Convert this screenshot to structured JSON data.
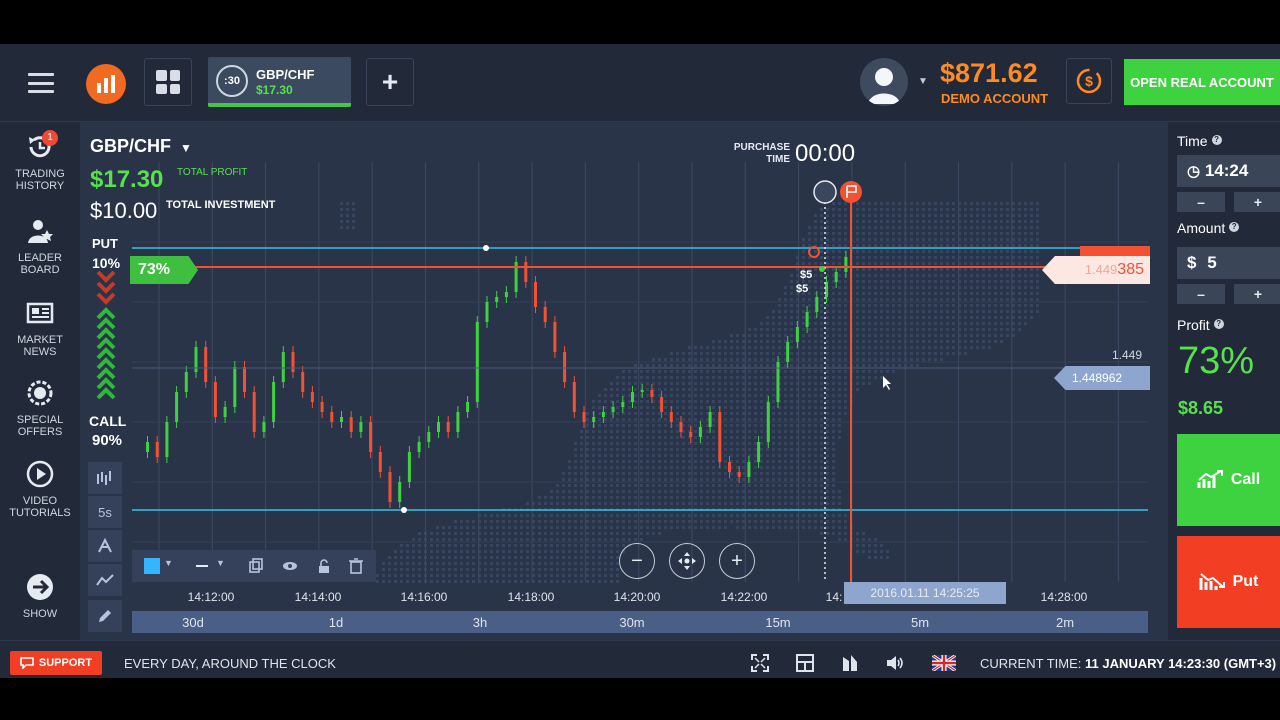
{
  "topbar": {
    "asset_tab": {
      "timer": ":30",
      "name": "GBP/CHF",
      "value": "$17.30"
    },
    "add_tab": "+",
    "balance": "$871.62",
    "account_type": "DEMO ACCOUNT",
    "open_real_label": "OPEN REAL ACCOUNT"
  },
  "sidebar": {
    "items": [
      {
        "label": "TRADING HISTORY",
        "icon": "history-icon",
        "badge": "1"
      },
      {
        "label": "LEADER BOARD",
        "icon": "leaderboard-icon"
      },
      {
        "label": "MARKET NEWS",
        "icon": "news-icon"
      },
      {
        "label": "SPECIAL OFFERS",
        "icon": "offers-icon"
      },
      {
        "label": "VIDEO TUTORIALS",
        "icon": "play-icon"
      },
      {
        "label": "SHOW",
        "icon": "arrow-right-icon"
      }
    ]
  },
  "chart": {
    "asset": "GBP/CHF",
    "total_profit": "$17.30",
    "total_profit_label": "TOTAL PROFIT",
    "total_investment": "$10.00",
    "total_investment_label": "TOTAL INVESTMENT",
    "purchase_time_label": "PURCHASE TIME",
    "purchase_time": "00:00",
    "put_label": "PUT",
    "put_pct": "10%",
    "call_label": "CALL",
    "call_pct": "90%",
    "flag_pct": "73%",
    "price_tag_main": "1.449",
    "price_tag_bold": "385",
    "level_value": "1.449",
    "blue_tag": "1.448962",
    "timeframe_button": "5s",
    "time_ticks": [
      "14:12:00",
      "14:14:00",
      "14:16:00",
      "14:18:00",
      "14:20:00",
      "14:22:00",
      "14:",
      "14:28:00"
    ],
    "timestamp_box": "2016.01.11 14:25:25",
    "periods": [
      "30d",
      "1d",
      "3h",
      "30m",
      "15m",
      "5m",
      "2m"
    ],
    "deal_labels": [
      "$5",
      "$5"
    ],
    "colors": {
      "up": "#3fd240",
      "down": "#f25233",
      "level": "#33c4e8"
    }
  },
  "right": {
    "time_label": "Time",
    "time_value": "14:24",
    "amount_label": "Amount",
    "amount_currency": "$",
    "amount_value": "5",
    "profit_label": "Profit",
    "profit_pct": "73%",
    "profit_amount": "$8.65",
    "call_label": "Call",
    "put_label": "Put",
    "minus": "–",
    "plus": "+"
  },
  "bottombar": {
    "support_label": "SUPPORT",
    "support_note": "EVERY DAY, AROUND THE CLOCK",
    "current_time_label": "CURRENT TIME:",
    "current_time_value": "11 JANUARY 14:23:30",
    "timezone": "(GMT+3)"
  }
}
